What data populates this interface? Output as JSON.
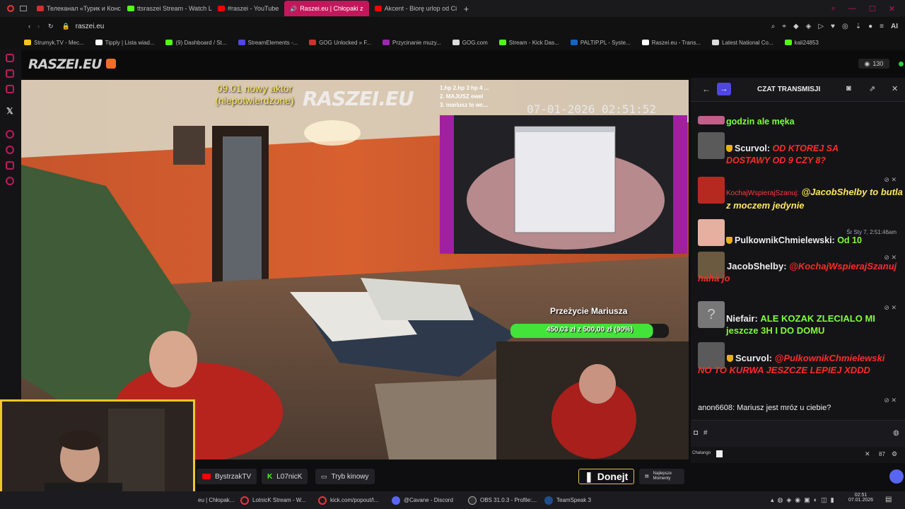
{
  "browser": {
    "tabs": [
      {
        "label": "Телеканал «Турик и Конс",
        "color": "#d32f2f"
      },
      {
        "label": "ttsraszei Stream - Watch L",
        "color": "#53fc18"
      },
      {
        "label": "#raszei - YouTube",
        "color": "#ff0000"
      },
      {
        "label": "Raszei.eu | Chłopaki z",
        "color": "#ffffff",
        "active": true
      },
      {
        "label": "Akcent - Biorę urlop od Ci",
        "color": "#ff0000"
      }
    ],
    "new_tab": "+",
    "url": "raszei.eu",
    "bookmarks": [
      {
        "label": "Strumyk.TV - Mec...",
        "color": "#f5c518"
      },
      {
        "label": "Tipply | Lista wiad...",
        "color": "#ffffff"
      },
      {
        "label": "(9) Dashboard / St...",
        "color": "#53fc18"
      },
      {
        "label": "StreamElements -...",
        "color": "#4f46e5"
      },
      {
        "label": "GOG Unlocked » F...",
        "color": "#d32f2f"
      },
      {
        "label": "Przycinanie muzy...",
        "color": "#9c27b0"
      },
      {
        "label": "GOG.com",
        "color": "#dddddd"
      },
      {
        "label": "Stream - Kick Das...",
        "color": "#53fc18"
      },
      {
        "label": "PALTIP.PL - Syste...",
        "color": "#1565c0"
      },
      {
        "label": "Raszei.eu - Trans...",
        "color": "#ffffff"
      },
      {
        "label": "Latest National Co...",
        "color": "#dddddd"
      },
      {
        "label": "kali24853",
        "color": "#53fc18"
      }
    ],
    "tray_ai": "AI"
  },
  "site": {
    "logo": "RASZEI.EU",
    "viewers": "130"
  },
  "video": {
    "overlay_actor_line1": "09.01 nowy aktor",
    "overlay_actor_line2": "(niepotwierdzone)",
    "overlay_logo": "RASZEI.EU",
    "top_donors": [
      "1.hp 2.hp 3 hp 4 ...",
      "2. MAJUSZ ewel",
      "3. mariusz te wc..."
    ],
    "timestamp": "07-01-2026 02:51:52",
    "goal_title": "Przeżycie Mariusza",
    "goal_amount": "450,03 zł z 500,00 zł (90%)",
    "goal_progress": 0.9
  },
  "chat": {
    "title": "CZAT TRANSMISJI",
    "messages": [
      {
        "user": "",
        "text": "godzin ale męka",
        "style": "gr"
      },
      {
        "user": "Scurvol:",
        "text": "OD KTOREJ SA DOSTAWY OD 9 CZY 8?",
        "style": "rd",
        "badge": true
      },
      {
        "user": "KochajWspierajSzanuj:",
        "text": "@JacobShelby to butla z moczem jedynie",
        "style": "mention"
      },
      {
        "user": "PulkownikChmielewski:",
        "text": "Od 10",
        "style": "gr",
        "badge": true,
        "time": "Śr Sty 7, 2:51:46am"
      },
      {
        "user": "JacobShelby:",
        "text": "@KochajWspierajSzanuj haha jo",
        "style": "rd"
      },
      {
        "user": "Niefair:",
        "text": "ALE KOZAK ZLECIALO MI jeszcze 3H I DO DOMU",
        "style": "gr"
      },
      {
        "user": "Scurvol:",
        "text": "@PulkownikChmielewski NO TO KURWA JESZCZE LEPIEJ XDDD",
        "style": "rd",
        "badge": true
      },
      {
        "user": "anon6608:",
        "text": "Mariusz jest mróz u ciebie?",
        "style": "plain"
      }
    ],
    "input_prefix": "#",
    "footer_label": "Chatango",
    "volume": "87"
  },
  "bottom": {
    "btn_yt": "BystrzakTV",
    "btn_kick": "L07nicK",
    "btn_cinema": "Tryb kinowy",
    "donate": "Donejt",
    "best_moments": "Najlepsze Momenty"
  },
  "taskbar": {
    "items": [
      "eu | Chłopak...",
      "LotnicK Stream - W...",
      "kick.com/popout/l...",
      "@Cavane - Discord",
      "OBS 31.0.3 - Profile:...",
      "TeamSpeak 3"
    ],
    "time": "02:51",
    "date": "07.01.2026"
  },
  "colors": {
    "accent": "#c2185b",
    "chat_green": "#7fff39",
    "chat_red": "#ff2a2a",
    "kick_green": "#53fc18"
  }
}
